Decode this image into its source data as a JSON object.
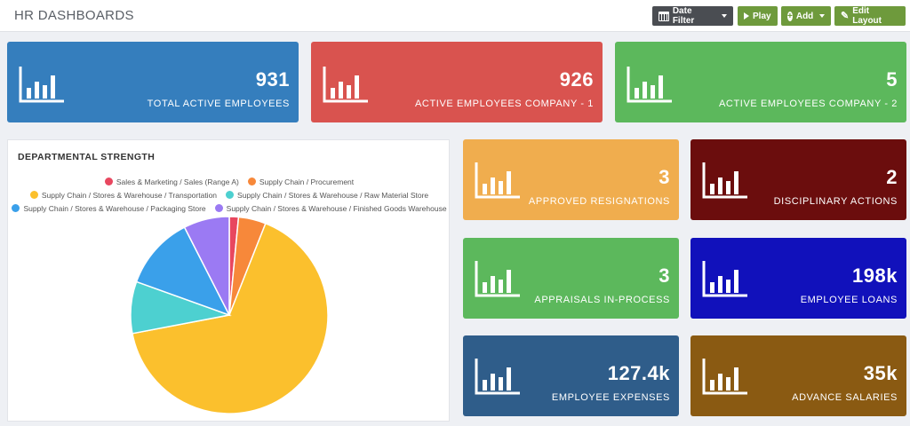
{
  "header": {
    "title": "HR DASHBOARDS",
    "date_filter_label": "Date Filter",
    "play_label": "Play",
    "add_label": "Add",
    "edit_layout_label": "Edit Layout"
  },
  "kpis": [
    {
      "value": "931",
      "label": "TOTAL ACTIVE EMPLOYEES",
      "color": "#357ebd"
    },
    {
      "value": "926",
      "label": "ACTIVE EMPLOYEES COMPANY - 1",
      "color": "#d9534f"
    },
    {
      "value": "5",
      "label": "ACTIVE EMPLOYEES COMPANY - 2",
      "color": "#5cb85c"
    },
    {
      "value": "3",
      "label": "APPROVED RESIGNATIONS",
      "color": "#f0ad4e"
    },
    {
      "value": "2",
      "label": "DISCIPLINARY ACTIONS",
      "color": "#6b0d0d"
    },
    {
      "value": "3",
      "label": "APPRAISALS IN-PROCESS",
      "color": "#5cb85c"
    },
    {
      "value": "198k",
      "label": "EMPLOYEE LOANS",
      "color": "#1111bb"
    },
    {
      "value": "127.4k",
      "label": "EMPLOYEE EXPENSES",
      "color": "#2f5d8a"
    },
    {
      "value": "35k",
      "label": "ADVANCE SALARIES",
      "color": "#8a5a12"
    }
  ],
  "panel": {
    "title": "DEPARTMENTAL STRENGTH"
  },
  "chart_data": {
    "type": "pie",
    "title": "DEPARTMENTAL STRENGTH",
    "legend_position": "top",
    "categories": [
      "Sales & Marketing / Sales (Range A)",
      "Supply Chain / Procurement",
      "Supply Chain / Stores & Warehouse / Transportation",
      "Supply Chain / Stores & Warehouse / Raw Material Store",
      "Supply Chain / Stores & Warehouse / Packaging Store",
      "Supply Chain / Stores & Warehouse / Finished Goods Warehouse"
    ],
    "values": [
      1.5,
      4.5,
      66,
      8.5,
      12,
      7.5
    ],
    "colors": [
      "#e8475f",
      "#f7883a",
      "#fbc02d",
      "#4dd0d0",
      "#3aa0ea",
      "#9b7af3"
    ]
  }
}
